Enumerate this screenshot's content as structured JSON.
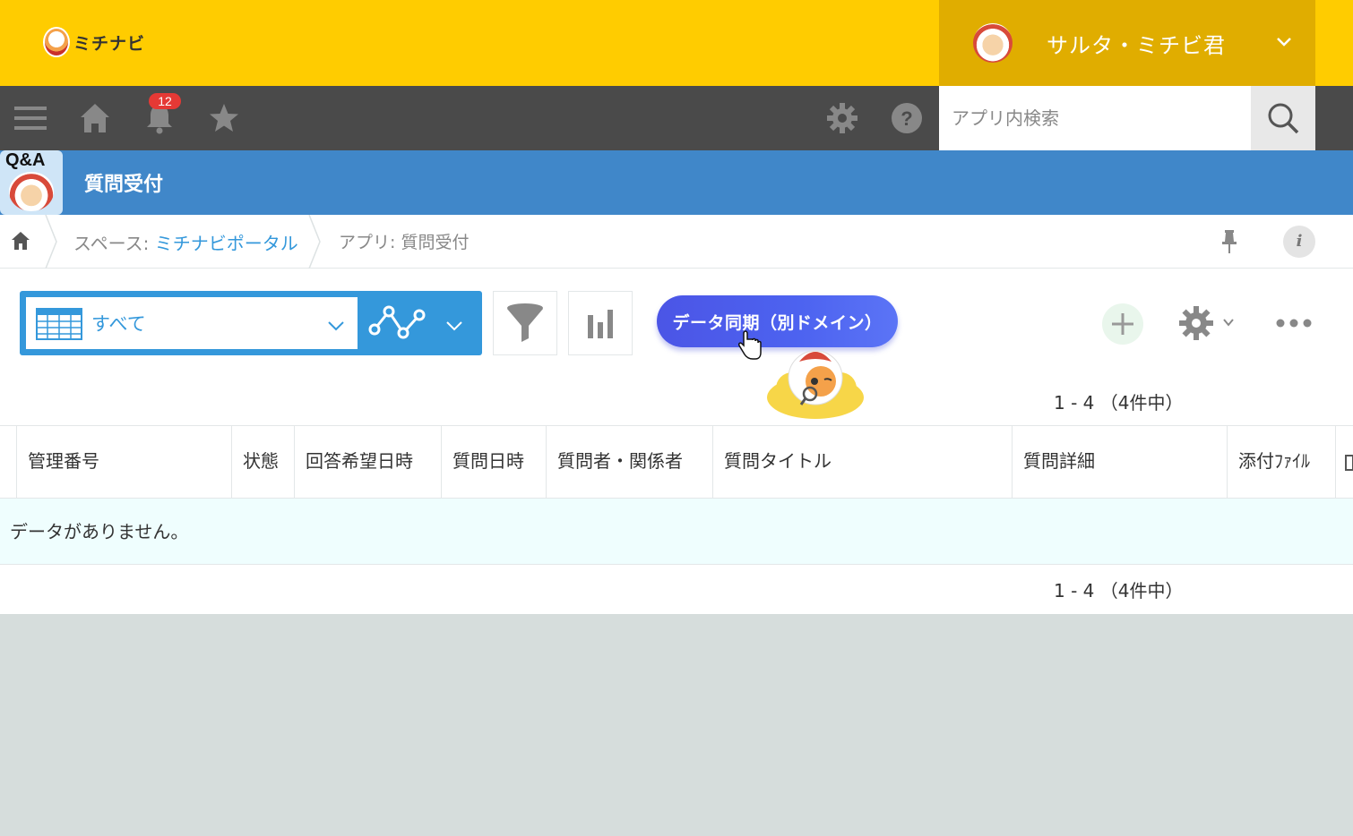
{
  "brand": {
    "name": "ミチナビ"
  },
  "user": {
    "name": "サルタ・ミチビ君"
  },
  "toolbar": {
    "notification_count": "12"
  },
  "search": {
    "placeholder": "アプリ内検索"
  },
  "app": {
    "title": "質問受付",
    "icon_label": "Q&A"
  },
  "breadcrumb": {
    "space_prefix": "スペース: ",
    "space_name": "ミチナビポータル",
    "app_label": "アプリ: 質問受付"
  },
  "view": {
    "selected": "すべて"
  },
  "sync_button": {
    "label": "データ同期（別ドメイン）"
  },
  "pager": {
    "range": "1 - 4 （4件中）"
  },
  "table": {
    "columns": [
      "管理番号",
      "状態",
      "回答希望日時",
      "質問日時",
      "質問者・関係者",
      "質問タイトル",
      "質問詳細",
      "添付ﾌｧｲﾙ"
    ],
    "empty_message": "データがありません。"
  },
  "colors": {
    "brand_yellow": "#ffcc00",
    "user_box": "#e0ad00",
    "toolbar_dark": "#4a4a4a",
    "app_header_blue": "#4087c9",
    "accent_blue": "#3498db",
    "sync_button": "#4d63f0"
  },
  "icons": [
    "menu-icon",
    "home-icon",
    "bell-icon",
    "star-icon",
    "gear-icon",
    "help-icon",
    "search-icon",
    "pin-icon",
    "info-icon",
    "table-view-icon",
    "graph-icon",
    "filter-icon",
    "bar-chart-icon",
    "plus-icon",
    "more-icon"
  ]
}
